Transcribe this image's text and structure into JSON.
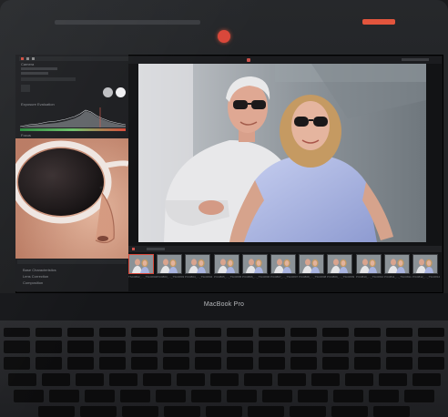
{
  "device": {
    "model_label": "MacBook Pro"
  },
  "app": {
    "left_panel": {
      "sections": [
        "Camera",
        "Exposure Evaluation",
        "Focus"
      ],
      "bottom_items": [
        "Base Characteristics",
        "Lens Correction",
        "Composition"
      ]
    },
    "filmstrip": {
      "thumbnails": [
        "TSC0802_..._TSC0802",
        "PIC0803_..._TSC0803",
        "PIC0804_..._TSC0804",
        "PIC0805_..._TSC0805",
        "PIC0806_..._TSC0806",
        "PIC0807_..._TSC0807",
        "PIC0808_..._TSC0808",
        "PIC0809_..._TSC0809",
        "PIC0810_..._TSC0810",
        "PIC0811_..._TSC0811",
        "PIC0812_..._TSC0812"
      ]
    }
  },
  "colors": {
    "camera_led": "#d9473a",
    "exposure_gradient": [
      "#2c8b3f",
      "#6ec06b",
      "#d94b3a"
    ],
    "shirt_blue": "#aab6e0",
    "sweater": "#e7e7e9"
  }
}
